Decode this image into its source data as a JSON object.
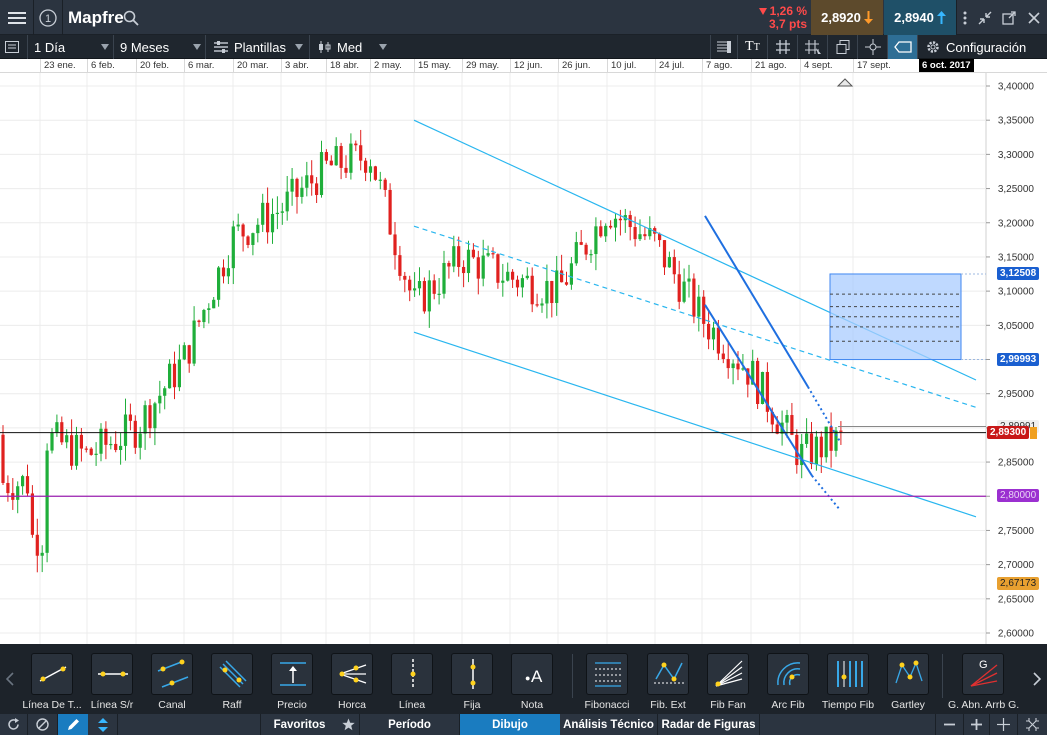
{
  "header": {
    "instrument": "Mapfre",
    "sell_change_pct": "1,26 %",
    "sell_change_pts": "3,7 pts",
    "sell_price": "2,8920",
    "buy_price": "2,8940",
    "colors": {
      "sell_bg": "#7a5a2a",
      "buy_bg": "#1f5c75",
      "down": "#ff4a4a",
      "up": "#37b7ff"
    }
  },
  "toolbar": {
    "interval": "1 Día",
    "range": "9 Meses",
    "templates": "Plantillas",
    "chart_style": "Med",
    "config": "Configuración"
  },
  "date_axis": {
    "labels": [
      "23 ene.",
      "6 feb.",
      "20 feb.",
      "6 mar.",
      "20 mar.",
      "3 abr.",
      "18 abr.",
      "2 may.",
      "15 may.",
      "29 may.",
      "12 jun.",
      "26 jun.",
      "10 jul.",
      "24 jul.",
      "7 ago.",
      "21 ago.",
      "4 sept.",
      "17 sept."
    ],
    "current_date": "6 oct. 2017"
  },
  "price_axis": {
    "labels": [
      "3,40000",
      "3,35000",
      "3,30000",
      "3,25000",
      "3,20000",
      "3,15000",
      "3,10000",
      "3,05000",
      "3,00000",
      "2,95000",
      "2,90000",
      "2,85000",
      "2,80000",
      "2,75000",
      "2,70000",
      "2,65000",
      "2,60000"
    ],
    "tags": {
      "upper_box": "3,12508",
      "lower_box": "2,99993",
      "current": "2,89300",
      "hidden_near_current": "2,89991",
      "support": "2,80000",
      "low": "2,67173"
    }
  },
  "chart_data": {
    "type": "candlestick",
    "instrument": "Mapfre",
    "interval": "1 Día",
    "range": "9 Meses",
    "ylim": [
      2.6,
      3.4
    ],
    "last_price": 2.893,
    "horizontal_lines": [
      2.893,
      2.8
    ],
    "drawings": {
      "fib_box_upper": 3.12508,
      "fib_box_lower": 2.99993
    },
    "approx_closes_by_period": [
      {
        "period": "23 ene.",
        "close": 2.89
      },
      {
        "period": "6 feb.",
        "close": 2.86
      },
      {
        "period": "20 feb.",
        "close": 2.9
      },
      {
        "period": "6 mar.",
        "close": 3.0
      },
      {
        "period": "20 mar.",
        "close": 3.18
      },
      {
        "period": "3 abr.",
        "close": 3.22
      },
      {
        "period": "18 abr.",
        "close": 3.28
      },
      {
        "period": "2 may.",
        "close": 3.3
      },
      {
        "period": "15 may.",
        "close": 3.08
      },
      {
        "period": "29 may.",
        "close": 3.15
      },
      {
        "period": "12 jun.",
        "close": 3.12
      },
      {
        "period": "26 jun.",
        "close": 3.1
      },
      {
        "period": "10 jul.",
        "close": 3.22
      },
      {
        "period": "24 jul.",
        "close": 3.17
      },
      {
        "period": "7 ago.",
        "close": 3.06
      },
      {
        "period": "21 ago.",
        "close": 2.98
      },
      {
        "period": "4 sept.",
        "close": 2.86
      },
      {
        "period": "17 sept.",
        "close": 2.89
      }
    ]
  },
  "tools": [
    {
      "label": "Línea De T...",
      "icon": "trendline-icon"
    },
    {
      "label": "Línea S/r",
      "icon": "horizontal-line-icon"
    },
    {
      "label": "Canal",
      "icon": "channel-icon"
    },
    {
      "label": "Raff",
      "icon": "raff-icon"
    },
    {
      "label": "Precio",
      "icon": "price-icon"
    },
    {
      "label": "Horca",
      "icon": "pitchfork-icon"
    },
    {
      "label": "Línea",
      "icon": "vertical-line-icon"
    },
    {
      "label": "Fija",
      "icon": "fixed-icon"
    },
    {
      "label": "Nota",
      "icon": "note-icon"
    },
    {
      "label": "Fibonacci",
      "icon": "fibonacci-icon"
    },
    {
      "label": "Fib. Ext",
      "icon": "fib-ext-icon"
    },
    {
      "label": "Fib Fan",
      "icon": "fib-fan-icon"
    },
    {
      "label": "Arc Fib",
      "icon": "arc-fib-icon"
    },
    {
      "label": "Tiempo Fib",
      "icon": "time-fib-icon"
    },
    {
      "label": "Gartley",
      "icon": "gartley-icon"
    },
    {
      "label": "G. Abn. Arrb G.",
      "icon": "gann-icon"
    }
  ],
  "bottom_tabs": {
    "favorites": "Favoritos",
    "period": "Período",
    "drawing": "Dibujo",
    "technical": "Análisis Técnico",
    "patterns": "Radar de Figuras"
  }
}
